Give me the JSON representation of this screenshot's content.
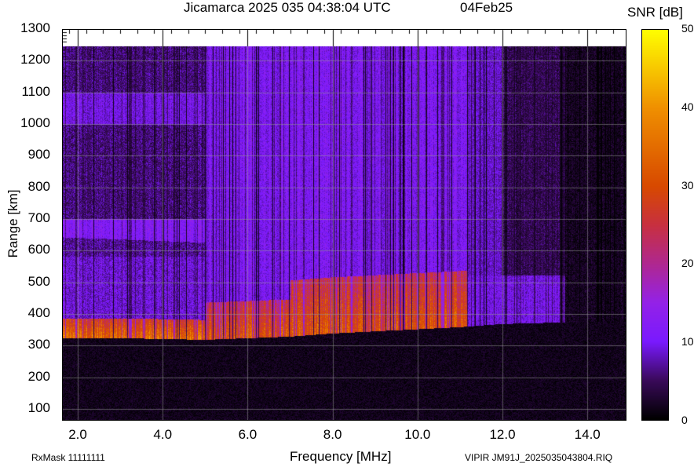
{
  "header": {
    "title": "Jicamarca 2025 035 04:38:04 UTC",
    "date": "04Feb25"
  },
  "footer": {
    "rxmask": "RxMask 11111111",
    "filename": "VIPIR  JM91J_2025035043804.RIQ"
  },
  "colors": {
    "c0": "#000000",
    "c5": "#3a0a5a",
    "c10": "#7a1aff",
    "c15": "#9422e8",
    "c20": "#b02890",
    "c25": "#c83040",
    "c30": "#d84a00",
    "c40": "#f09000",
    "c50": "#ffff00"
  },
  "chart_data": {
    "type": "heatmap",
    "title": "Jicamarca 2025 035 04:38:04 UTC",
    "xlabel": "Frequency [MHz]",
    "ylabel": "Range [km]",
    "xlim": [
      1.63,
      14.92
    ],
    "ylim": [
      63,
      1300
    ],
    "data_max_range_km": 1245,
    "xticks": [
      "2.0",
      "4.0",
      "6.0",
      "8.0",
      "10.0",
      "12.0",
      "14.0"
    ],
    "xtick_values": [
      2,
      4,
      6,
      8,
      10,
      12,
      14
    ],
    "yticks": [
      "100",
      "200",
      "300",
      "400",
      "500",
      "600",
      "700",
      "800",
      "900",
      "1000",
      "1100",
      "1200",
      "1300"
    ],
    "ytick_values": [
      100,
      200,
      300,
      400,
      500,
      600,
      700,
      800,
      900,
      1000,
      1100,
      1200,
      1300
    ],
    "grid": true,
    "colorbar": {
      "label": "SNR [dB]",
      "range": [
        0,
        50
      ],
      "ticks": [
        "0",
        "10",
        "20",
        "30",
        "40",
        "50"
      ],
      "tick_values": [
        0,
        10,
        20,
        30,
        40,
        50
      ]
    },
    "trace_lower_edge": {
      "frequency_mhz": [
        1.7,
        3.0,
        5.0,
        7.0,
        8.0,
        9.5,
        11.0,
        12.0,
        14.9
      ],
      "range_km": [
        330,
        330,
        325,
        335,
        345,
        355,
        365,
        375,
        385
      ]
    },
    "strong_echo": {
      "frequency_mhz": [
        1.7,
        11.0
      ],
      "range_km": [
        320,
        500
      ],
      "snr_db": [
        25,
        38
      ]
    },
    "diffuse_echo_bands_low_freq": [
      {
        "range_km": [
          580,
          700
        ]
      },
      {
        "range_km": [
          1000,
          1100
        ]
      }
    ]
  }
}
